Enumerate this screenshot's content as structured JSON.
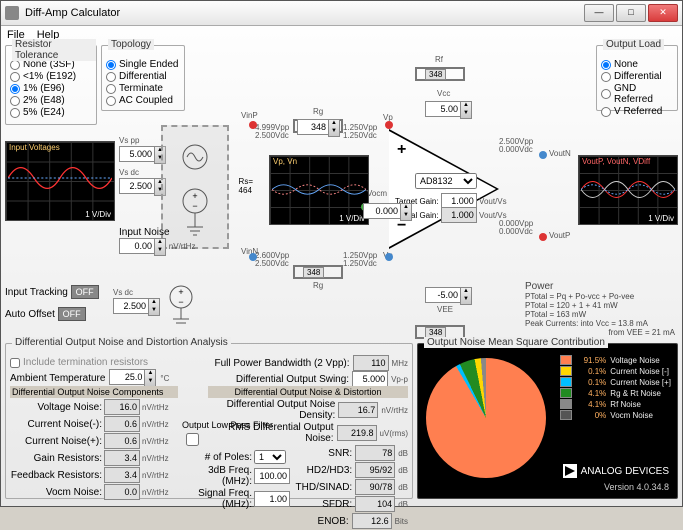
{
  "title": "Diff-Amp Calculator",
  "menu": {
    "file": "File",
    "help": "Help"
  },
  "groups": {
    "tol": {
      "title": "Resistor Tolerance",
      "opts": [
        "None (3SF)",
        "<1% (E192)",
        "1% (E96)",
        "2% (E48)",
        "5% (E24)"
      ],
      "sel": 2
    },
    "topo": {
      "title": "Topology",
      "opts": [
        "Single Ended",
        "Differential",
        "Terminate",
        "AC Coupled"
      ],
      "sel": 0
    },
    "load": {
      "title": "Output Load",
      "opts": [
        "None",
        "Differential",
        "GND Referred",
        "V Referred"
      ],
      "sel": 0
    }
  },
  "inputs": {
    "vspp_lbl": "Vs pp",
    "vspp": "5.000",
    "vsdc_lbl": "Vs dc",
    "vsdc": "2.500",
    "noise_lbl": "Input Noise",
    "noise": "0.00",
    "noise_unit": "nV/rtHz",
    "rs_lbl": "Rs=",
    "rs_val": "464"
  },
  "tracking": {
    "lbl": "Input Tracking",
    "btn": "OFF"
  },
  "offset": {
    "lbl": "Auto Offset",
    "btn": "OFF",
    "vsdc_lbl": "Vs dc",
    "vsdc": "2.500"
  },
  "circuit": {
    "rf": "Rf",
    "rf_val": "348",
    "rg": "Rg",
    "rg_val": "348",
    "vinp": "VinP",
    "vinn": "VinN",
    "vp": "Vp",
    "vn": "Vn",
    "voutn": "VoutN",
    "voutp": "VoutP",
    "vcc": "Vcc",
    "vcc_val": "5.00",
    "vee": "VEE",
    "vee_val": "-5.00",
    "vocm": "Vocm",
    "vocm_val": "0.000",
    "part": "AD8132",
    "tgain_lbl": "Target Gain:",
    "tgain": "1.000",
    "tgain_unit": "Vout/Vs",
    "again_lbl": "Actual Gain:",
    "again": "1.000",
    "again_unit": "Vout/Vs",
    "vp_top": "4.999Vpp",
    "vp_top2": "2.500Vdc",
    "vn_top": "2.600Vpp",
    "vn_top2": "2.500Vdc",
    "vp_r": "1.250Vpp",
    "vp_r2": "1.250Vdc",
    "vout_top": "2.500Vpp",
    "vout_top2": "0.000Vdc",
    "vout_bot": "0.000Vpp",
    "vout_bot2": "0.000Vdc"
  },
  "power": {
    "title": "Power",
    "l1": "PTotal = Pq + Po-vcc + Po-vee",
    "l2": "PTotal = 120 + 1 + 41 mW",
    "l3": "PTotal = 163 mW",
    "l4": "Peak Currents: into Vcc = 13.8 mA",
    "l5": "from VEE = 21 mA"
  },
  "scopes": {
    "in": {
      "title": "Input Voltages",
      "footer": "1 V/Div"
    },
    "mid": {
      "title": "Vp, Vn",
      "footer": "1 V/Div"
    },
    "out": {
      "title": "VoutP, VoutN, VDiff",
      "footer": "1 V/Div"
    }
  },
  "analysis": {
    "title": "Differential Output Noise and Distortion Analysis",
    "term": "Include termination resistors",
    "amb_lbl": "Ambient Temperature",
    "amb": "25.0",
    "amb_unit": "°C",
    "comp_title": "Differential Output Noise Components",
    "rows": [
      {
        "lbl": "Voltage Noise:",
        "v": "16.0",
        "u": "nV/rtHz"
      },
      {
        "lbl": "Current Noise(-):",
        "v": "0.6",
        "u": "nV/rtHz"
      },
      {
        "lbl": "Current Noise(+):",
        "v": "0.6",
        "u": "nV/rtHz"
      },
      {
        "lbl": "Gain Resistors:",
        "v": "3.4",
        "u": "nV/rtHz"
      },
      {
        "lbl": "Feedback Resistors:",
        "v": "3.4",
        "u": "nV/rtHz"
      },
      {
        "lbl": "Vocm Noise:",
        "v": "0.0",
        "u": "nV/rtHz"
      }
    ],
    "lpf": {
      "title": "Output Low Pass Filter",
      "poles_lbl": "# of Poles:",
      "poles": "1",
      "f3_lbl": "3dB Freq. (MHz):",
      "f3": "100.00",
      "sig_lbl": "Signal Freq. (MHz):",
      "sig": "1.00"
    },
    "dist_title": "Differential Output Noise & Distortion",
    "fp_lbl": "Full Power Bandwidth (2 Vpp):",
    "fp": "110",
    "fp_u": "MHz",
    "swing_lbl": "Differential Output Swing:",
    "swing": "5.000",
    "swing_u": "Vp-p",
    "drows": [
      {
        "lbl": "Differential Output Noise Density:",
        "v": "16.7",
        "u": "nV/rtHz"
      },
      {
        "lbl": "RMS Differential Output Noise:",
        "v": "219.8",
        "u": "uV(rms)"
      },
      {
        "lbl": "SNR:",
        "v": "78",
        "u": "dB"
      },
      {
        "lbl": "HD2/HD3:",
        "v": "95/92",
        "u": "dB"
      },
      {
        "lbl": "THD/SINAD:",
        "v": "90/78",
        "u": "dB"
      },
      {
        "lbl": "SFDR:",
        "v": "104",
        "u": "dB"
      },
      {
        "lbl": "ENOB:",
        "v": "12.6",
        "u": "Bits"
      }
    ]
  },
  "pie": {
    "title": "Output Noise Mean Square Contribution",
    "legend": [
      {
        "pct": "91.5%",
        "lbl": "Voltage Noise",
        "c": "#ff7f50"
      },
      {
        "pct": "0.1%",
        "lbl": "Current Noise [-]",
        "c": "#ffd700"
      },
      {
        "pct": "0.1%",
        "lbl": "Current Noise [+]",
        "c": "#00bfff"
      },
      {
        "pct": "4.1%",
        "lbl": "Rg & Rt Noise",
        "c": "#228b22"
      },
      {
        "pct": "4.1%",
        "lbl": "Rf Noise",
        "c": "#888"
      },
      {
        "pct": "0%",
        "lbl": "Vocm Noise",
        "c": "#555"
      }
    ],
    "brand": "ANALOG DEVICES",
    "ver": "Version 4.0.34.8"
  },
  "chart_data": {
    "type": "pie",
    "title": "Output Noise Mean Square Contribution",
    "series": [
      {
        "name": "Voltage Noise",
        "value": 91.5
      },
      {
        "name": "Current Noise [-]",
        "value": 0.1
      },
      {
        "name": "Current Noise [+]",
        "value": 0.1
      },
      {
        "name": "Rg & Rt Noise",
        "value": 4.1
      },
      {
        "name": "Rf Noise",
        "value": 4.1
      },
      {
        "name": "Vocm Noise",
        "value": 0
      }
    ]
  }
}
